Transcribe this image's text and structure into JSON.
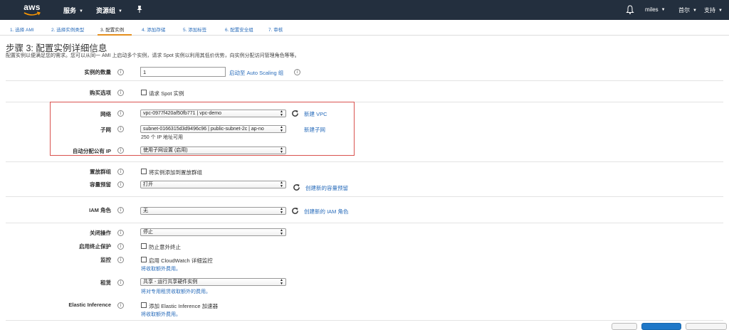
{
  "brand": {
    "logo_text": "aws"
  },
  "topnav": {
    "services_label": "服务",
    "resource_groups_label": "资源组",
    "user_label": "miles",
    "region_label": "首尔",
    "support_label": "支持"
  },
  "wizard_tabs": [
    {
      "label": "1. 选择 AMI"
    },
    {
      "label": "2. 选择实例类型"
    },
    {
      "label": "3. 配置实例"
    },
    {
      "label": "4. 添加存储"
    },
    {
      "label": "5. 添加标签"
    },
    {
      "label": "6. 配置安全组"
    },
    {
      "label": "7. 审核"
    }
  ],
  "page": {
    "title": "步骤 3: 配置实例详细信息",
    "description": "配置实例以便满足您的需求。您可以从同一 AMI 上启动多个实例，请求 Spot 实例以利用其低价优势，向实例分配访问管理角色等等。"
  },
  "form": {
    "instance_count": {
      "label": "实例的数量",
      "value": "1",
      "link": "启动至 Auto Scaling 组"
    },
    "purchase_option": {
      "label": "购买选项",
      "checkbox_label": "请求 Spot 实例"
    },
    "network": {
      "label": "网络",
      "value": "vpc-0977f420af50fb771 | vpc-demo",
      "link": "新建 VPC"
    },
    "subnet": {
      "label": "子网",
      "value": "subnet-0166315d3d9496c96 | public-subnet-2c | ap-no",
      "ip_note": "250 个 IP 地址可用",
      "link": "新建子网"
    },
    "auto_public_ip": {
      "label": "自动分配公有 IP",
      "value": "使用子网设置 (启用)"
    },
    "placement_group": {
      "label": "置放群组",
      "checkbox_label": "将实例添加到置放群组"
    },
    "capacity_reservation": {
      "label": "容量预留",
      "value": "打开",
      "link": "创建新的容量预留"
    },
    "iam_role": {
      "label": "IAM 角色",
      "value": "无",
      "link": "创建新的 IAM 角色"
    },
    "shutdown_behavior": {
      "label": "关闭操作",
      "value": "停止"
    },
    "termination_protection": {
      "label": "启用终止保护",
      "checkbox_label": "防止意外终止"
    },
    "monitoring": {
      "label": "监控",
      "checkbox_label": "启用 CloudWatch 详细监控",
      "note": "将收取额外费用。"
    },
    "tenancy": {
      "label": "租赁",
      "value": "共享 - 运行共享硬件实例",
      "note": "将对专用租赁收取额外的费用。"
    },
    "elastic_inference": {
      "label": "Elastic Inference",
      "checkbox_label": "添加 Elastic Inference 加速器",
      "note": "将收取额外费用。"
    }
  },
  "icons": {
    "info": "i",
    "refresh": "refresh-icon",
    "bell": "bell-icon",
    "pin": "pin-icon"
  },
  "colors": {
    "nav_bg": "#232f3e",
    "link": "#2a6dbb",
    "active_tab_underline": "#e58f1e",
    "highlight_border": "#d9534f",
    "primary_button": "#1f78c8"
  }
}
